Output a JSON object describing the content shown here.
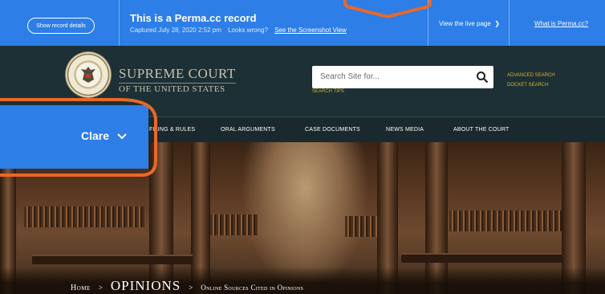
{
  "perma": {
    "show_details": "Show record details",
    "title": "This is a Perma.cc record",
    "captured": "Captured July 28, 2020 2:52 pm",
    "looks_wrong": "Looks wrong?",
    "screenshot_link": "See the Screenshot View",
    "live_page": "View the live page",
    "what_is": "What is Perma.cc?"
  },
  "header": {
    "court_line1": "SUPREME COURT",
    "court_line2": "OF THE UNITED STATES",
    "search_placeholder": "Search Site for...",
    "search_tips": "SEARCH TIPS",
    "advanced_search": "ADVANCED SEARCH",
    "docket_search": "DOCKET SEARCH"
  },
  "nav": {
    "items": [
      "FILING & RULES",
      "ORAL ARGUMENTS",
      "CASE DOCUMENTS",
      "NEWS MEDIA",
      "ABOUT THE COURT"
    ]
  },
  "breadcrumb": {
    "home": "Home",
    "sep": ">",
    "current": "OPINIONS",
    "sub": "Online Sources Cited in Opinions"
  },
  "user": {
    "name": "Clare"
  },
  "colors": {
    "perma_blue": "#2d7ee6",
    "header_bg": "#1d3035",
    "gold": "#c89c38",
    "callout_orange": "#e8682a"
  },
  "icons": [
    "search-icon",
    "chevron-down-icon",
    "chevron-right-icon",
    "court-seal"
  ]
}
